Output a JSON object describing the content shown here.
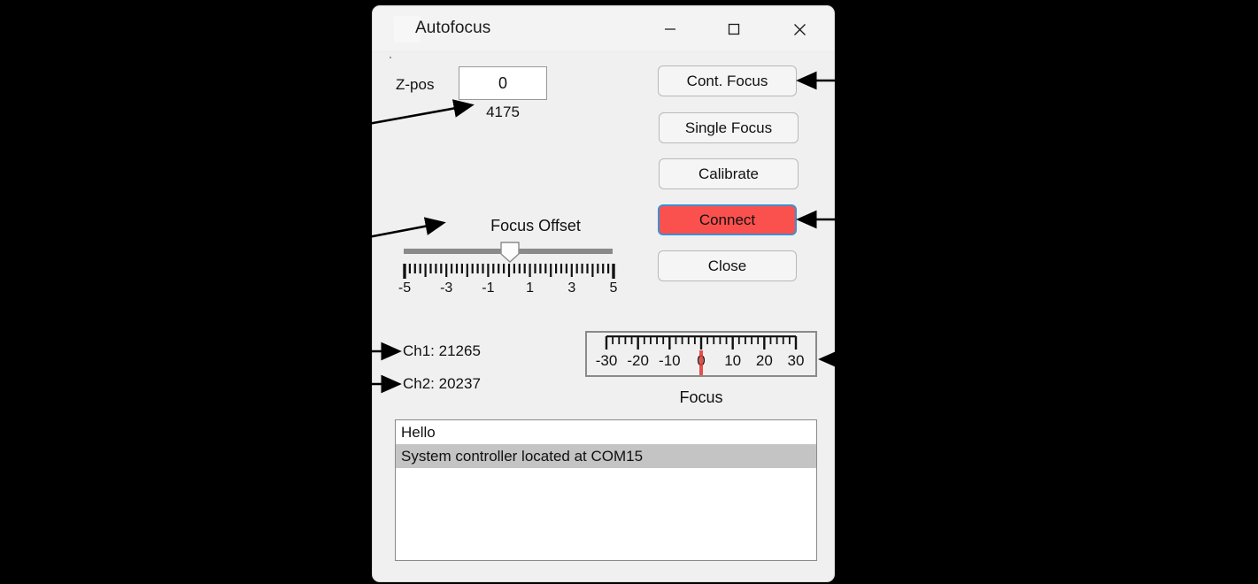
{
  "window": {
    "title": "Autofocus",
    "controls": {
      "minimize_icon": "minimize-icon",
      "maximize_icon": "maximize-icon",
      "close_icon": "close-icon"
    }
  },
  "zpos": {
    "label": "Z-pos",
    "value": "0",
    "placeholder": "0",
    "readout": "4175"
  },
  "buttons": {
    "cont_focus": "Cont. Focus",
    "single_focus": "Single Focus",
    "calibrate": "Calibrate",
    "connect": "Connect",
    "close": "Close"
  },
  "focus_offset": {
    "label": "Focus Offset",
    "value": 0,
    "min": -5,
    "max": 5,
    "tick_labels": [
      "-5",
      "-3",
      "-1",
      "1",
      "3",
      "5"
    ],
    "tick_label_values": [
      -5,
      -3,
      -1,
      1,
      3,
      5
    ],
    "major_ticks": [
      -5,
      -4,
      -3,
      -2,
      -1,
      0,
      1,
      2,
      3,
      4,
      5
    ],
    "minor_per_major": 4
  },
  "channels": {
    "ch1": "Ch1: 21265",
    "ch2": "Ch2: 20237"
  },
  "focus_gauge": {
    "label": "Focus",
    "value": 0,
    "min": -30,
    "max": 30,
    "tick_labels": [
      "-30",
      "-20",
      "-10",
      "0",
      "10",
      "20",
      "30"
    ],
    "tick_label_values": [
      -30,
      -20,
      -10,
      0,
      10,
      20,
      30
    ],
    "minor_step": 2,
    "needle_color": "#e8312a"
  },
  "log": {
    "items": [
      {
        "text": "Hello",
        "selected": false
      },
      {
        "text": "System controller located at COM15",
        "selected": true
      }
    ]
  },
  "colors": {
    "connect_button": "#fa514f",
    "connect_focus_ring": "#3f8fd0",
    "window_background": "#f0f0f0",
    "titlebar": "#f3f3f3",
    "selection": "#c4c4c4",
    "backdrop": "#000000"
  },
  "annotations": {
    "arrow_count": 5,
    "targets": [
      "zpos-readout",
      "cont-focus-button",
      "focus-offset-label",
      "connect-button",
      "ch1-readout",
      "ch2-readout",
      "focus-gauge"
    ]
  }
}
